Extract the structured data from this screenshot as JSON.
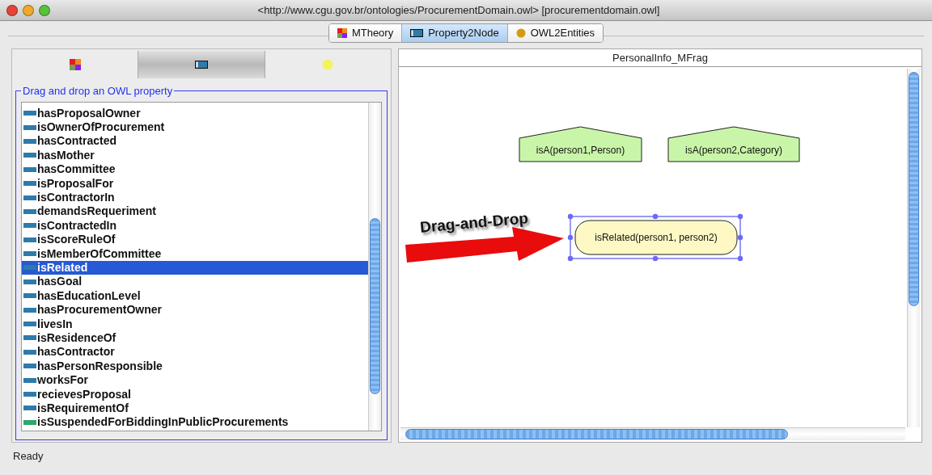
{
  "window": {
    "title": "<http://www.cgu.gov.br/ontologies/ProcurementDomain.owl> [procurementdomain.owl]"
  },
  "tabs": [
    {
      "label": "MTheory",
      "kind": "mtheory",
      "selected": false
    },
    {
      "label": "Property2Node",
      "kind": "property",
      "selected": true
    },
    {
      "label": "OWL2Entities",
      "kind": "entity",
      "selected": false
    }
  ],
  "left_panel": {
    "icon_tabs": [
      {
        "kind": "mtheory",
        "selected": false
      },
      {
        "kind": "property",
        "selected": true
      },
      {
        "kind": "entity",
        "selected": false
      }
    ],
    "group_title": "Drag and drop an OWL property",
    "properties": [
      {
        "label": "hasProposalOwner",
        "color": "#2e7bab",
        "selected": false
      },
      {
        "label": "isOwnerOfProcurement",
        "color": "#2e7bab",
        "selected": false
      },
      {
        "label": "hasContracted",
        "color": "#2e7bab",
        "selected": false
      },
      {
        "label": "hasMother",
        "color": "#2e7bab",
        "selected": false
      },
      {
        "label": "hasCommittee",
        "color": "#2e7bab",
        "selected": false
      },
      {
        "label": "isProposalFor",
        "color": "#2e7bab",
        "selected": false
      },
      {
        "label": "isContractorIn",
        "color": "#2e7bab",
        "selected": false
      },
      {
        "label": "demandsRequeriment",
        "color": "#2e7bab",
        "selected": false
      },
      {
        "label": "isContractedIn",
        "color": "#2e7bab",
        "selected": false
      },
      {
        "label": "isScoreRuleOf",
        "color": "#2e7bab",
        "selected": false
      },
      {
        "label": "isMemberOfCommittee",
        "color": "#2e7bab",
        "selected": false
      },
      {
        "label": "isRelated",
        "color": "#2e7bab",
        "selected": true
      },
      {
        "label": "hasGoal",
        "color": "#2e7bab",
        "selected": false
      },
      {
        "label": "hasEducationLevel",
        "color": "#2e7bab",
        "selected": false
      },
      {
        "label": "hasProcurementOwner",
        "color": "#2e7bab",
        "selected": false
      },
      {
        "label": "livesIn",
        "color": "#2e7bab",
        "selected": false
      },
      {
        "label": "isResidenceOf",
        "color": "#2e7bab",
        "selected": false
      },
      {
        "label": "hasContractor",
        "color": "#2e7bab",
        "selected": false
      },
      {
        "label": "hasPersonResponsible",
        "color": "#2e7bab",
        "selected": false
      },
      {
        "label": "worksFor",
        "color": "#2e7bab",
        "selected": false
      },
      {
        "label": "recievesProposal",
        "color": "#2e7bab",
        "selected": false
      },
      {
        "label": "isRequirementOf",
        "color": "#2e7bab",
        "selected": false
      },
      {
        "label": "isSuspendedForBiddingInPublicProcurements",
        "color": "#2ea86b",
        "selected": false
      }
    ]
  },
  "mfrag": {
    "title": "PersonalInfo_MFrag",
    "nodes": [
      {
        "kind": "context",
        "label": "isA(person1,Person)",
        "selected": false
      },
      {
        "kind": "context",
        "label": "isA(person2,Category)",
        "selected": false
      },
      {
        "kind": "resident",
        "label": "isRelated(person1, person2)",
        "selected": true
      }
    ],
    "annotation": {
      "text": "Drag-and-Drop"
    }
  },
  "status_bar": {
    "text": "Ready"
  }
}
